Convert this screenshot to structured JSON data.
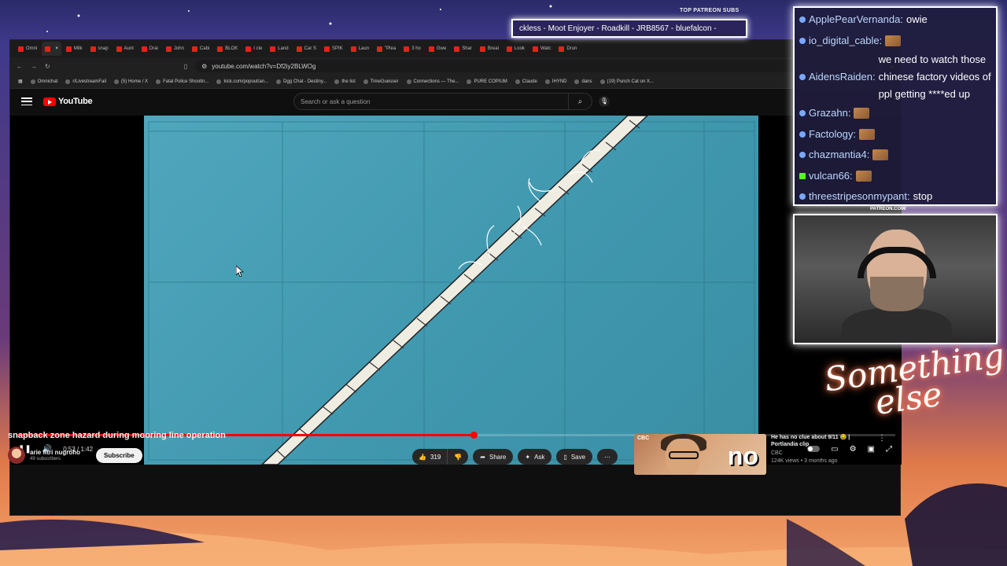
{
  "browser": {
    "tabs": [
      {
        "label": "Omni",
        "active": false
      },
      {
        "label": "",
        "active": true
      },
      {
        "label": "Milk",
        "active": false
      },
      {
        "label": "snap",
        "active": false
      },
      {
        "label": "Aunt",
        "active": false
      },
      {
        "label": "Drai",
        "active": false
      },
      {
        "label": "John",
        "active": false
      },
      {
        "label": "Cabi",
        "active": false
      },
      {
        "label": "BLOK",
        "active": false
      },
      {
        "label": "I cle",
        "active": false
      },
      {
        "label": "Land",
        "active": false
      },
      {
        "label": "Car S",
        "active": false
      },
      {
        "label": "SPIK",
        "active": false
      },
      {
        "label": "Laun",
        "active": false
      },
      {
        "label": "\"Plea",
        "active": false
      },
      {
        "label": "3 ho",
        "active": false
      },
      {
        "label": "Gwe",
        "active": false
      },
      {
        "label": "Shar",
        "active": false
      },
      {
        "label": "Breal",
        "active": false
      },
      {
        "label": "Look",
        "active": false
      },
      {
        "label": "Watc",
        "active": false
      },
      {
        "label": "Drun",
        "active": false
      }
    ],
    "url": "youtube.com/watch?v=Df2iy2BLWOg",
    "bookmarks": [
      "Omnichat",
      "r/LivestreamFail",
      "(5) Home / X",
      "Fatal Police Shootin...",
      "kick.com/popout/an...",
      "Dgg Chat - Destiny...",
      "the list",
      "TimeGuesser",
      "Connections — The...",
      "PURE COPIUM",
      "Claude",
      "IHYND",
      "dans",
      "(19) Punch Cat on X..."
    ]
  },
  "youtube": {
    "logo_text": "YouTube",
    "search_placeholder": "Search or ask a question",
    "player": {
      "time_current": "0:53",
      "time_total": "1:42",
      "time_display": "0:53 / 1:42",
      "progress_fraction": 0.52
    },
    "video": {
      "title": "snapback zone hazard during mooring line operation",
      "channel": "arie fitri nugroho",
      "subscribers": "49 subscribers",
      "subscribe_label": "Subscribe",
      "likes": "319",
      "share_label": "Share",
      "ask_label": "Ask",
      "save_label": "Save"
    },
    "recommendation": {
      "thumb_text": "no",
      "thumb_badge": "CBC",
      "title": "He has no clue about 9/11 😂 | Portlandia clip",
      "channel": "CBC",
      "stats": "124K views • 3 months ago"
    }
  },
  "overlay": {
    "patreon_header": "TOP PATREON SUBS",
    "ticker": "ckless - Moot Enjoyer - Roadkill - JRB8567 - bluefalcon -",
    "patreon_url": "PATREON.COM/",
    "logo_text_line1": "Something",
    "logo_text_line2": "else",
    "chat": [
      {
        "user": "ApplePearVernanda:",
        "msg": "owie",
        "badge": "twitch"
      },
      {
        "user": "io_digital_cable:",
        "msg": "",
        "badge": "twitch"
      },
      {
        "user": "AidensRaiden:",
        "msg": "we need to watch those chinese factory videos of ppl getting ****ed up",
        "badge": "twitch"
      },
      {
        "user": "Grazahn:",
        "msg": "",
        "badge": "twitch"
      },
      {
        "user": "Factology:",
        "msg": "",
        "badge": "twitch"
      },
      {
        "user": "chazmantia4:",
        "msg": "",
        "badge": "twitch"
      },
      {
        "user": "vulcan66:",
        "msg": "",
        "badge": "kick"
      },
      {
        "user": "threestripesonmypant:",
        "msg": "stop",
        "badge": "twitch"
      }
    ]
  },
  "colors": {
    "yt_red": "#ff0000",
    "video_bg": "#4fa6bd",
    "overlay_border": "#ffffff"
  }
}
